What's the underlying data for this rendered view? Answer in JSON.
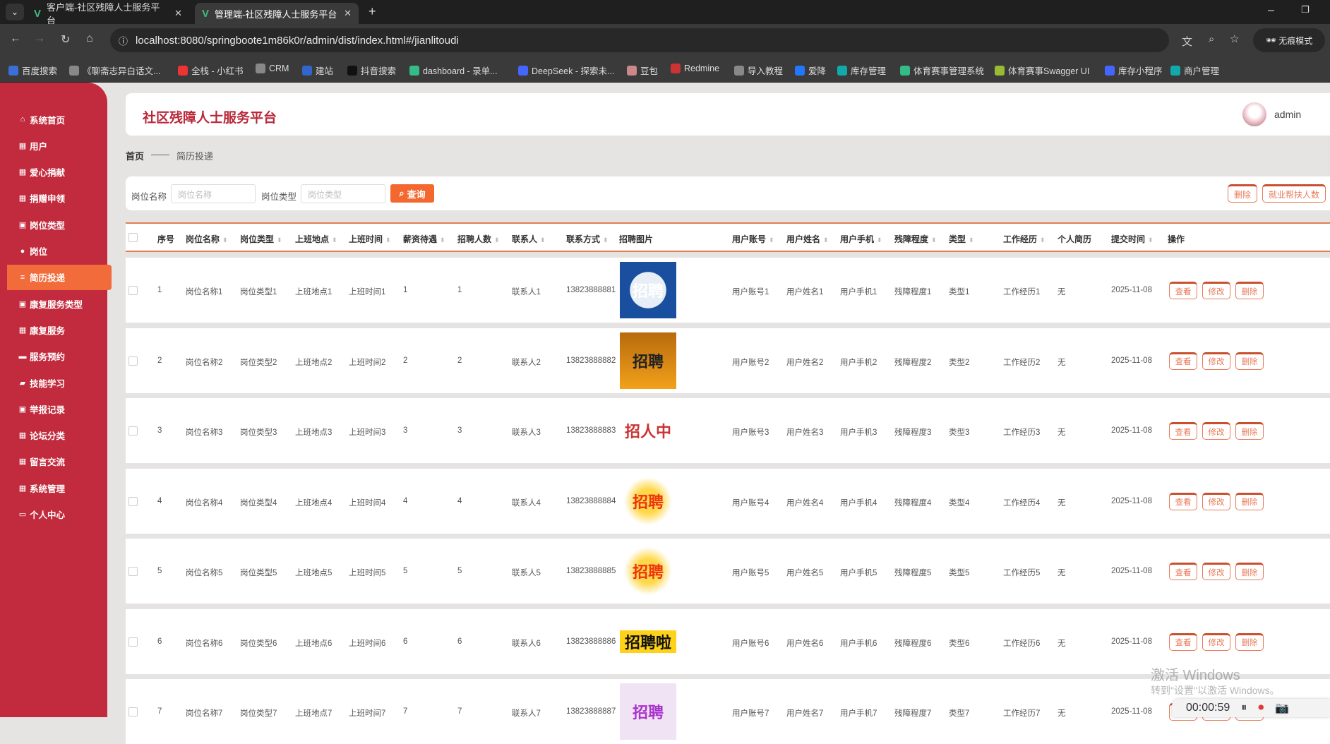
{
  "browser": {
    "tabs": [
      {
        "label": "客户端-社区残障人士服务平台"
      },
      {
        "label": "管理端-社区残障人士服务平台"
      }
    ],
    "url": "localhost:8080/springboote1m86k0r/admin/dist/index.html#/jianlitoudi",
    "incognito": "无痕模式",
    "bookmarks": [
      "百度搜索",
      "《聊斋志异白话文...",
      "全栈 - 小红书",
      "CRM",
      "建站",
      "抖音搜索",
      "dashboard - 录单...",
      "DeepSeek - 探索未...",
      "豆包",
      "Redmine",
      "导入教程",
      "爱降",
      "库存管理",
      "体育赛事管理系统",
      "体育赛事Swagger UI",
      "库存小程序",
      "商户管理"
    ]
  },
  "sidebar": {
    "items": [
      {
        "label": "系统首页",
        "icon": "home-icon"
      },
      {
        "label": "用户",
        "icon": "grid-icon"
      },
      {
        "label": "爱心捐献",
        "icon": "grid-icon"
      },
      {
        "label": "捐赠申领",
        "icon": "grid-icon"
      },
      {
        "label": "岗位类型",
        "icon": "clipboard-icon"
      },
      {
        "label": "岗位",
        "icon": "user-icon"
      },
      {
        "label": "简历投递",
        "icon": "list-icon"
      },
      {
        "label": "康复服务类型",
        "icon": "clipboard-icon"
      },
      {
        "label": "康复服务",
        "icon": "grid-icon"
      },
      {
        "label": "服务预约",
        "icon": "monitor-icon"
      },
      {
        "label": "技能学习",
        "icon": "briefcase-icon"
      },
      {
        "label": "举报记录",
        "icon": "clipboard-icon"
      },
      {
        "label": "论坛分类",
        "icon": "grid-icon"
      },
      {
        "label": "留言交流",
        "icon": "grid-icon"
      },
      {
        "label": "系统管理",
        "icon": "grid-icon"
      },
      {
        "label": "个人中心",
        "icon": "card-icon"
      }
    ],
    "active": "简历投递"
  },
  "header": {
    "title": "社区残障人士服务平台",
    "user": "admin"
  },
  "breadcrumb": {
    "home": "首页",
    "sep": "——",
    "current": "简历投递"
  },
  "search": {
    "name_label": "岗位名称",
    "name_placeholder": "岗位名称",
    "type_label": "岗位类型",
    "type_placeholder": "岗位类型",
    "query": "查询",
    "delete": "删除",
    "stats": "就业帮扶人数"
  },
  "table": {
    "columns": [
      "序号",
      "岗位名称",
      "岗位类型",
      "上班地点",
      "上班时间",
      "薪资待遇",
      "招聘人数",
      "联系人",
      "联系方式",
      "招聘图片",
      "用户账号",
      "用户姓名",
      "用户手机",
      "残障程度",
      "类型",
      "工作经历",
      "个人简历",
      "提交时间",
      "操作"
    ],
    "actions": {
      "view": "查看",
      "edit": "修改",
      "delete": "删除"
    },
    "rows": [
      [
        "1",
        "岗位名称1",
        "岗位类型1",
        "上班地点1",
        "上班时间1",
        "1",
        "1",
        "联系人1",
        "13823888881",
        "招聘",
        "用户账号1",
        "用户姓名1",
        "用户手机1",
        "残障程度1",
        "类型1",
        "工作经历1",
        "无",
        "2025-11-08"
      ],
      [
        "2",
        "岗位名称2",
        "岗位类型2",
        "上班地点2",
        "上班时间2",
        "2",
        "2",
        "联系人2",
        "13823888882",
        "招聘",
        "用户账号2",
        "用户姓名2",
        "用户手机2",
        "残障程度2",
        "类型2",
        "工作经历2",
        "无",
        "2025-11-08"
      ],
      [
        "3",
        "岗位名称3",
        "岗位类型3",
        "上班地点3",
        "上班时间3",
        "3",
        "3",
        "联系人3",
        "13823888883",
        "招人中",
        "用户账号3",
        "用户姓名3",
        "用户手机3",
        "残障程度3",
        "类型3",
        "工作经历3",
        "无",
        "2025-11-08"
      ],
      [
        "4",
        "岗位名称4",
        "岗位类型4",
        "上班地点4",
        "上班时间4",
        "4",
        "4",
        "联系人4",
        "13823888884",
        "招聘",
        "用户账号4",
        "用户姓名4",
        "用户手机4",
        "残障程度4",
        "类型4",
        "工作经历4",
        "无",
        "2025-11-08"
      ],
      [
        "5",
        "岗位名称5",
        "岗位类型5",
        "上班地点5",
        "上班时间5",
        "5",
        "5",
        "联系人5",
        "13823888885",
        "招聘",
        "用户账号5",
        "用户姓名5",
        "用户手机5",
        "残障程度5",
        "类型5",
        "工作经历5",
        "无",
        "2025-11-08"
      ],
      [
        "6",
        "岗位名称6",
        "岗位类型6",
        "上班地点6",
        "上班时间6",
        "6",
        "6",
        "联系人6",
        "13823888886",
        "招聘啦",
        "用户账号6",
        "用户姓名6",
        "用户手机6",
        "残障程度6",
        "类型6",
        "工作经历6",
        "无",
        "2025-11-08"
      ],
      [
        "7",
        "岗位名称7",
        "岗位类型7",
        "上班地点7",
        "上班时间7",
        "7",
        "7",
        "联系人7",
        "13823888887",
        "招聘",
        "用户账号7",
        "用户姓名7",
        "用户手机7",
        "残障程度7",
        "类型7",
        "工作经历7",
        "无",
        "2025-11-08"
      ]
    ]
  },
  "watermark": {
    "line1": "激活 Windows",
    "line2": "转到\"设置\"以激活 Windows。"
  },
  "recorder": {
    "time": "00:00:59"
  },
  "colors": {
    "sidebar": "#c22b3d",
    "accent": "#f26b3a",
    "title": "#b8283a"
  }
}
